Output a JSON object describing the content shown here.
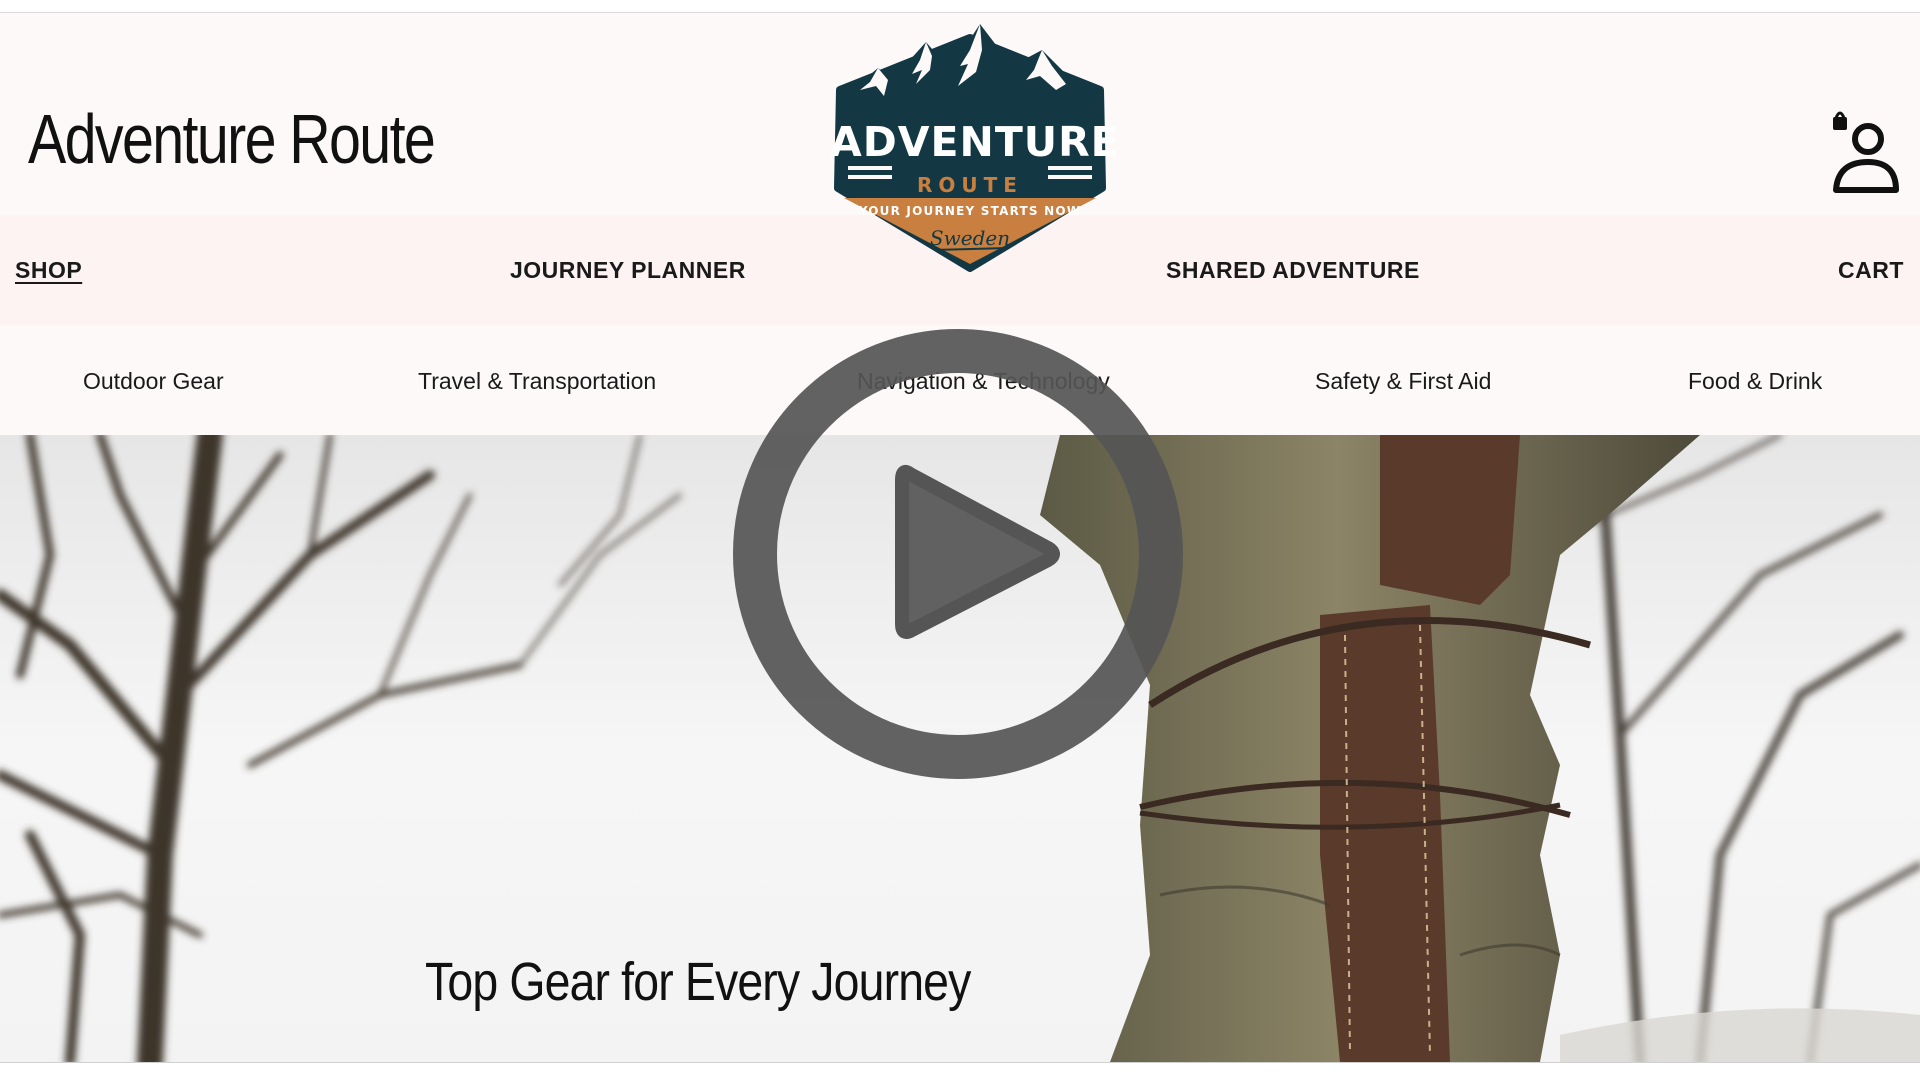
{
  "header": {
    "brand_title": "Adventure Route",
    "account_icon": "account-bag-icon"
  },
  "logo": {
    "title": "ADVENTURE",
    "subtitle": "ROUTE",
    "tagline": "YOUR JOURNEY STARTS NOW",
    "country": "Sweden",
    "colors": {
      "navy": "#133844",
      "copper": "#c87f3f"
    }
  },
  "main_nav": {
    "items": [
      {
        "label": "SHOP",
        "active": true
      },
      {
        "label": "JOURNEY PLANNER",
        "active": false
      },
      {
        "label": "SHARED ADVENTURE",
        "active": false
      },
      {
        "label": "CART",
        "active": false
      }
    ]
  },
  "sub_nav": {
    "items": [
      {
        "label": "Outdoor Gear"
      },
      {
        "label": "Travel & Transportation"
      },
      {
        "label": "Navigation & Technology"
      },
      {
        "label": "Safety & First Aid"
      },
      {
        "label": "Food & Drink"
      }
    ]
  },
  "hero": {
    "caption": "Top Gear for Every Journey",
    "play_icon": "play-icon"
  }
}
